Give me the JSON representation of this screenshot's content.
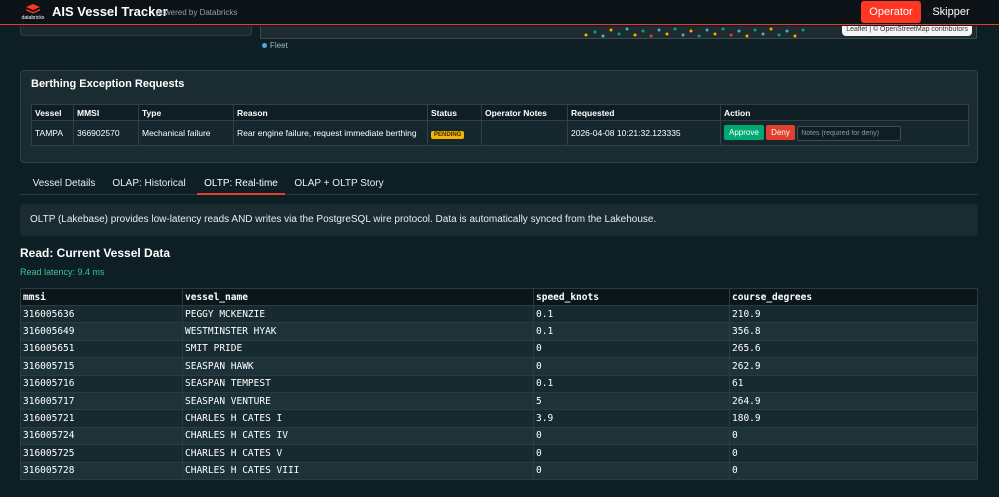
{
  "header": {
    "logo_text": "databricks",
    "title": "AIS Vessel Tracker",
    "powered_by": "powered by Databricks",
    "operator_label": "Operator",
    "skipper_label": "Skipper",
    "accent_color": "#ff3621"
  },
  "map": {
    "attribution": "Leaflet | © OpenStreetMap contributors",
    "legend_fleet": "Fleet"
  },
  "berthing": {
    "title": "Berthing Exception Requests",
    "columns": [
      "Vessel",
      "MMSI",
      "Type",
      "Reason",
      "Status",
      "Operator Notes",
      "Requested",
      "Action"
    ],
    "rows": [
      {
        "vessel": "TAMPA",
        "mmsi": "366902570",
        "type": "Mechanical failure",
        "reason": "Rear engine failure, request immediate berthing",
        "status": "PENDING",
        "operator_notes": "",
        "requested": "2026-04-08 10:21:32.123335",
        "approve_label": "Approve",
        "deny_label": "Deny",
        "notes_placeholder": "Notes (required for deny)"
      }
    ]
  },
  "tabs": [
    {
      "label": "Vessel Details"
    },
    {
      "label": "OLAP: Historical"
    },
    {
      "label": "OLTP: Real-time"
    },
    {
      "label": "OLAP + OLTP Story"
    }
  ],
  "active_tab": "OLTP: Real-time",
  "info_text": "OLTP (Lakebase) provides low-latency reads AND writes via the PostgreSQL wire protocol. Data is automatically synced from the Lakehouse.",
  "read_section": {
    "title": "Read: Current Vessel Data",
    "latency": "Read latency: 9.4 ms",
    "columns": [
      "mmsi",
      "vessel_name",
      "speed_knots",
      "course_degrees"
    ],
    "rows": [
      [
        "316005636",
        "PEGGY MCKENZIE",
        "0.1",
        "210.9"
      ],
      [
        "316005649",
        "WESTMINSTER HYAK",
        "0.1",
        "356.8"
      ],
      [
        "316005651",
        "SMIT PRIDE",
        "0",
        "265.6"
      ],
      [
        "316005715",
        "SEASPAN HAWK",
        "0",
        "262.9"
      ],
      [
        "316005716",
        "SEASPAN TEMPEST",
        "0.1",
        "61"
      ],
      [
        "316005717",
        "SEASPAN VENTURE",
        "5",
        "264.9"
      ],
      [
        "316005721",
        "CHARLES H CATES I",
        "3.9",
        "180.9"
      ],
      [
        "316005724",
        "CHARLES H CATES IV",
        "0",
        "0"
      ],
      [
        "316005725",
        "CHARLES H CATES V",
        "0",
        "0"
      ],
      [
        "316005728",
        "CHARLES H CATES VIII",
        "0",
        "0"
      ]
    ]
  }
}
